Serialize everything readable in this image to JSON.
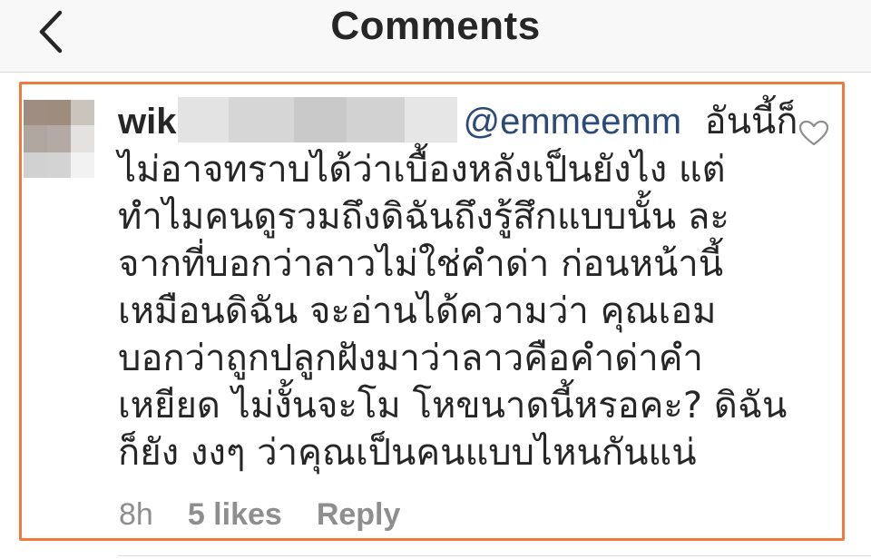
{
  "header": {
    "title": "Comments",
    "back_icon": "chevron-left-icon"
  },
  "comment": {
    "username_visible": "wik",
    "mention": "@emmeemm",
    "first_line_tail": "อันนี้ก็",
    "lines": [
      "ไม่อาจทราบได้ว่าเบื้องหลังเป็นยังไง แต่",
      "ทำไมคนดูรวมถึงดิฉันถึงรู้สึกแบบนั้น ละ",
      "จากที่บอกว่าลาวไม่ใช่คำด่า ก่อนหน้านี้",
      "เหมือนดิฉัน จะอ่านได้ความว่า คุณเอม",
      "บอกว่าถูกปลูกฝังมาว่าลาวคือคำด่าคำ",
      "เหยียด ไม่งั้นจะโม โหขนาดนี้หรอคะ? ดิฉัน",
      "ก็ยัง งงๆ ว่าคุณเป็นคนแบบไหนกันแน่"
    ],
    "timestamp": "8h",
    "likes": "5 likes",
    "reply_label": "Reply",
    "like_icon": "heart-outline-icon"
  },
  "colors": {
    "highlight_border": "#ee7a3c",
    "mention": "#2c4a78",
    "meta_text": "#8e8e8e",
    "header_bg": "#f8f8f8"
  }
}
